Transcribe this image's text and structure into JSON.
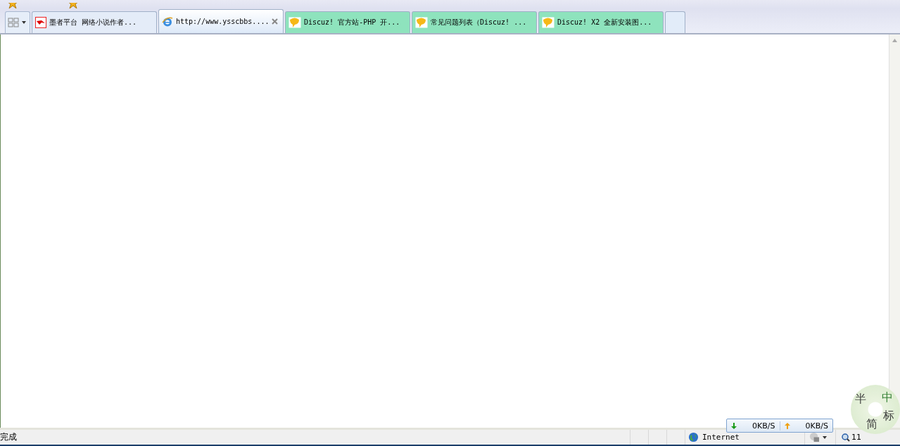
{
  "tabs": [
    {
      "label": "墨者平台 网络小说作者...",
      "kind": "moze",
      "selected": false,
      "closable": false,
      "color": "#e4ecf8"
    },
    {
      "label": "http://www.ysscbbs....",
      "kind": "ie",
      "selected": true,
      "closable": true,
      "color": "#e4ecf8"
    },
    {
      "label": "Discuz! 官方站-PHP 开...",
      "kind": "discuz",
      "selected": false,
      "closable": false,
      "color": "#8ee3bd"
    },
    {
      "label": "常见问题列表（Discuz! ...",
      "kind": "discuz",
      "selected": false,
      "closable": false,
      "color": "#8ee3bd"
    },
    {
      "label": "Discuz! X2 全新安装图...",
      "kind": "discuz",
      "selected": false,
      "closable": false,
      "color": "#8ee3bd"
    }
  ],
  "status_bar": {
    "text": "完成",
    "zone": "Internet",
    "zoom": "11"
  },
  "speed": {
    "down": "0KB/S",
    "up": "0KB/S"
  },
  "ime": {
    "chars": [
      "半",
      "中",
      "标",
      "简"
    ]
  }
}
